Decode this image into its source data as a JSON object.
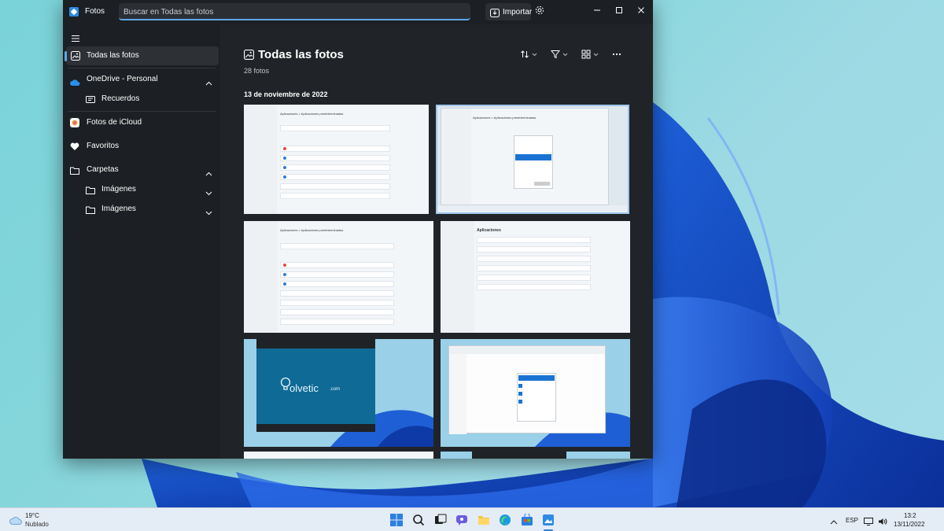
{
  "app": {
    "title": "Fotos"
  },
  "search": {
    "placeholder": "Buscar en Todas las fotos"
  },
  "toolbar": {
    "import_label": "Importar"
  },
  "sidebar": {
    "items": [
      {
        "label": "Todas las fotos",
        "icon": "photos-icon"
      },
      {
        "label": "OneDrive - Personal",
        "icon": "cloud-icon"
      },
      {
        "label": "Recuerdos",
        "icon": "memories-icon"
      },
      {
        "label": "Fotos de iCloud",
        "icon": "icloud-icon"
      },
      {
        "label": "Favoritos",
        "icon": "heart-icon"
      },
      {
        "label": "Carpetas",
        "icon": "folder-icon"
      },
      {
        "label": "Imágenes",
        "icon": "folder-icon"
      },
      {
        "label": "Imágenes",
        "icon": "folder-icon"
      }
    ]
  },
  "main": {
    "title": "Todas las fotos",
    "count": "28 fotos",
    "date_header": "13 de noviembre de 2022"
  },
  "thumbs": {
    "t1_title": "Aplicaciones  >  Aplicaciones predeterminadas",
    "t2_title": "Aplicaciones  >  Aplicaciones predeterminadas",
    "t3_title": "Aplicaciones  >  Aplicaciones predeterminadas",
    "t4_title": "Aplicaciones",
    "logo_text": "olvetic",
    "logo_suffix": ".com"
  },
  "taskbar": {
    "temperature": "19°C",
    "condition": "Nublado",
    "language": "ESP",
    "time": "13:2",
    "date": "13/11/2022"
  },
  "colors": {
    "accent": "#5ea8e8",
    "window_bg": "#202428",
    "sidebar_bg": "#1c1f23",
    "taskbar_bg": "#e4ecf5"
  }
}
